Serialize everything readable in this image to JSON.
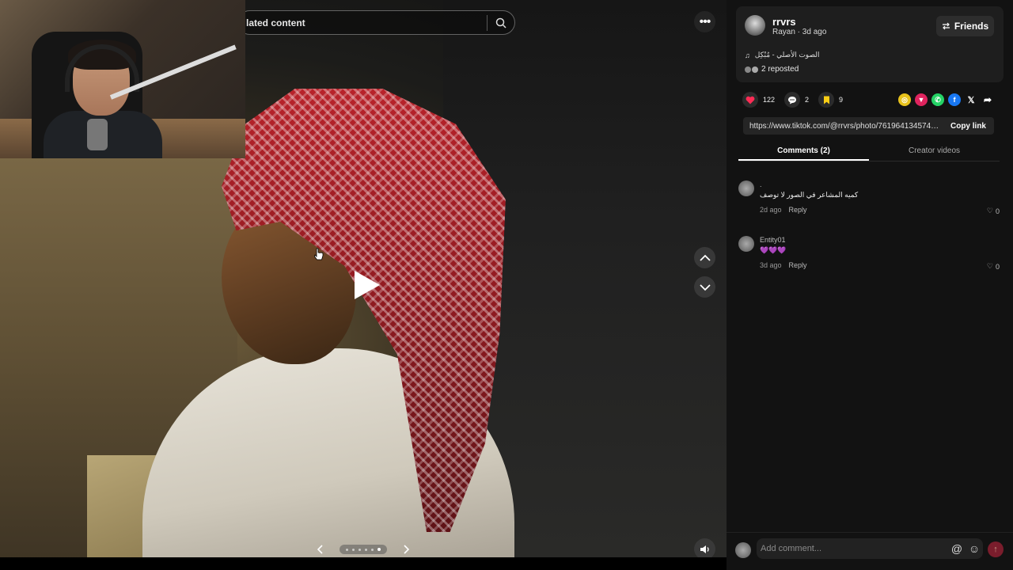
{
  "search": {
    "placeholder_text": "lated content"
  },
  "panel": {
    "author": {
      "username": "rrvrs",
      "display_name": "Rayan",
      "time": "3d ago",
      "separator": " · "
    },
    "friends_label": "Friends",
    "music": "الصوت الأصلي - مُبْكِل",
    "reposted": "2 reposted",
    "actions": {
      "likes": "122",
      "comments": "2",
      "saves": "9"
    },
    "link": {
      "url": "https://www.tiktok.com/@rrvrs/photo/76196413457407...",
      "copy_label": "Copy link"
    },
    "tabs": [
      {
        "label": "Comments (2)",
        "active": true
      },
      {
        "label": "Creator videos",
        "active": false
      }
    ],
    "comments": [
      {
        "name": ".",
        "text": "كميه المشاعر في الصور لا توصف",
        "time": "2d ago",
        "reply": "Reply",
        "likes": "0"
      },
      {
        "name": "Entity01",
        "text": "💜💜💜",
        "time": "3d ago",
        "reply": "Reply",
        "likes": "0"
      }
    ],
    "comment_input": {
      "placeholder": "Add comment..."
    }
  },
  "share_colors": [
    "#e8c21c",
    "#e0245e",
    "#25d366",
    "#1877f2",
    "#121212",
    "#121212"
  ],
  "accent_colors": {
    "like": "#fe2c55",
    "save": "#face15"
  }
}
